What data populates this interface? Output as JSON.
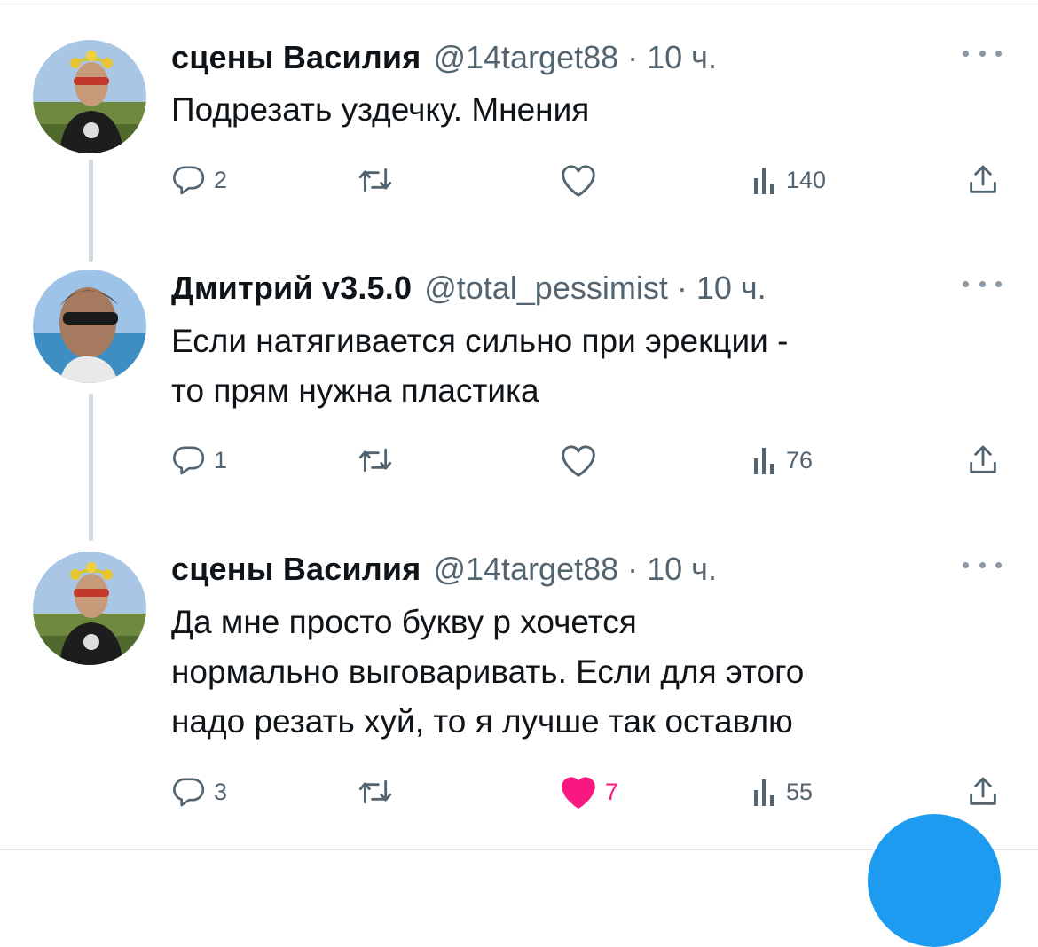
{
  "accent_color": "#1d9bf0",
  "like_color": "#f91880",
  "tweets": [
    {
      "name": "сцены Василия",
      "handle": "@14target88",
      "separator": "·",
      "time": "10 ч.",
      "lines": [
        "Подрезать уздечку. Мнения"
      ],
      "reply_count": "2",
      "retweet_count": "",
      "like_count": "",
      "liked": false,
      "views_count": "140"
    },
    {
      "name": "Дмитрий v3.5.0",
      "handle": "@total_pessimist",
      "separator": "·",
      "time": "10 ч.",
      "lines": [
        "Если натягивается сильно при эрекции -",
        "то прям нужна пластика"
      ],
      "reply_count": "1",
      "retweet_count": "",
      "like_count": "",
      "liked": false,
      "views_count": "76"
    },
    {
      "name": "сцены Василия",
      "handle": "@14target88",
      "separator": "·",
      "time": "10 ч.",
      "lines": [
        "Да мне просто букву р хочется",
        "нормально выговаривать. Если для этого",
        "надо резать хуй, то я лучше так оставлю"
      ],
      "reply_count": "3",
      "retweet_count": "",
      "like_count": "7",
      "liked": true,
      "views_count": "55"
    }
  ],
  "icons": {
    "reply": "reply-icon",
    "retweet": "retweet-icon",
    "like": "heart-icon",
    "views": "views-icon",
    "share": "share-icon",
    "more": "more-icon",
    "compose": "compose-fab"
  }
}
